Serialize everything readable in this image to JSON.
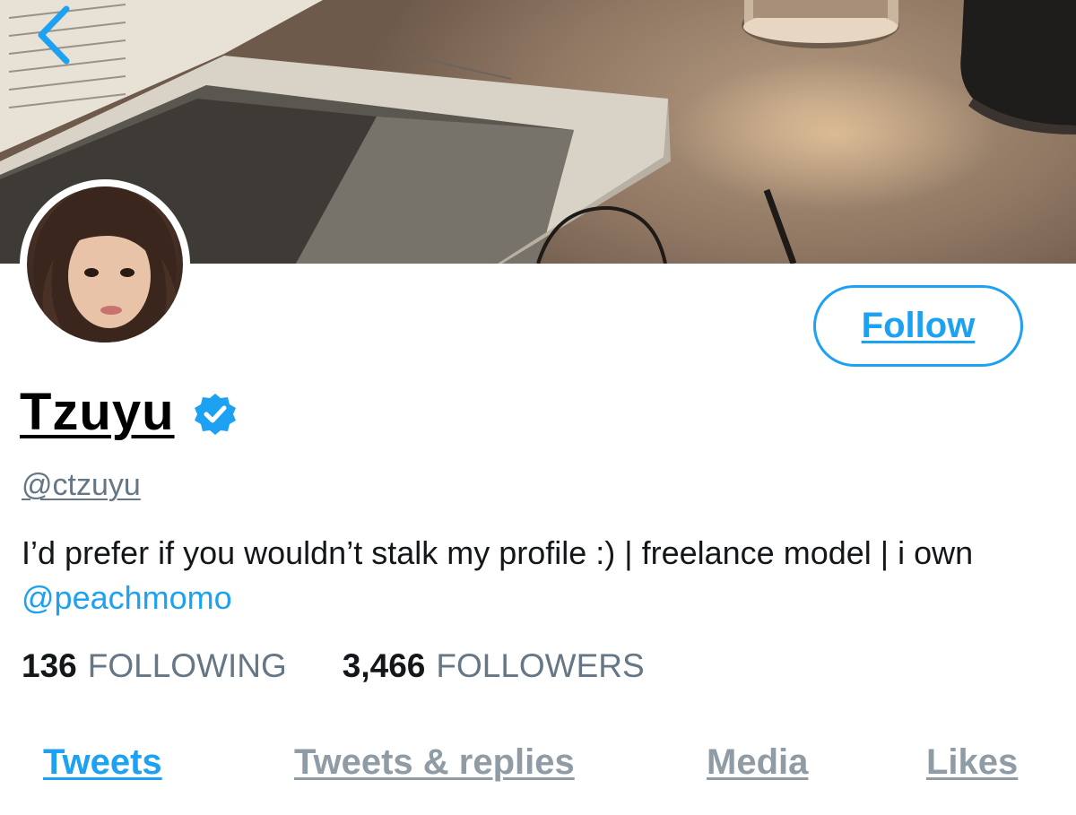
{
  "colors": {
    "accent": "#1da1f2",
    "secondary_text": "#657786",
    "tab_inactive": "#8f9ba5"
  },
  "header": {
    "back_icon": "chevron-left-icon",
    "banner_image": "desk-book-candle-photo"
  },
  "profile": {
    "avatar_icon": "profile-photo",
    "name": "Tzuyu",
    "verified_icon": "verified-badge-icon",
    "handle": "@ctzuyu",
    "bio_text": "I’d prefer if you wouldn’t stalk my profile :) | freelance model | i own ",
    "bio_mention": "@peachmomo",
    "follow_label": "Follow"
  },
  "stats": {
    "following_count": "136",
    "following_label": "FOLLOWING",
    "followers_count": "3,466",
    "followers_label": "FOLLOWERS"
  },
  "tabs": [
    {
      "label": "Tweets",
      "active": true
    },
    {
      "label": "Tweets & replies",
      "active": false
    },
    {
      "label": "Media",
      "active": false
    },
    {
      "label": "Likes",
      "active": false
    }
  ]
}
